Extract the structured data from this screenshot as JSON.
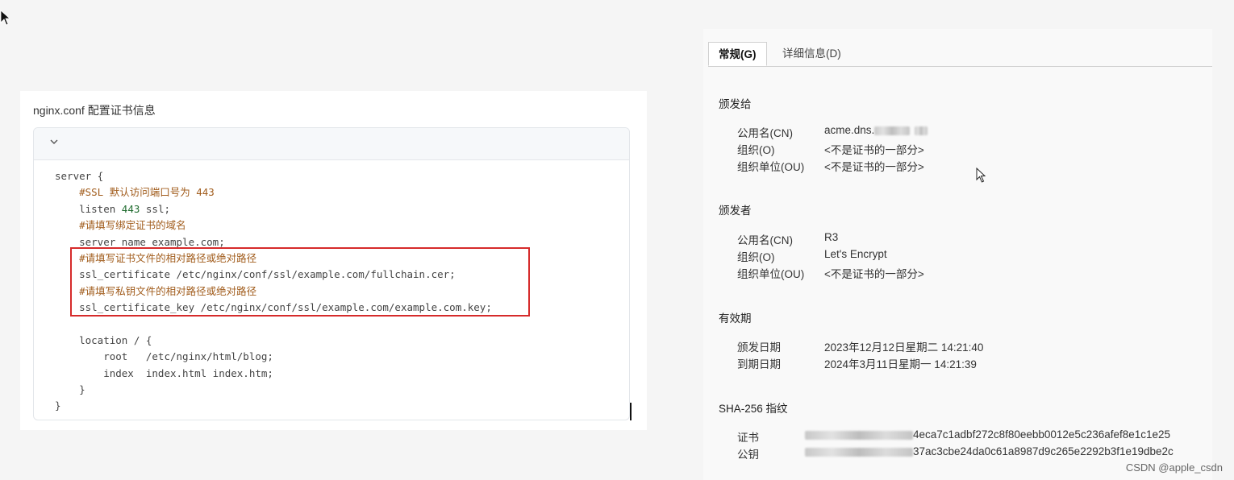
{
  "left": {
    "title": "nginx.conf 配置证书信息",
    "code_lines": [
      [
        {
          "t": "server {",
          "c": "kw"
        }
      ],
      [
        {
          "t": "    #SSL 默认访问端口号为 443",
          "c": "cm"
        }
      ],
      [
        {
          "t": "    listen ",
          "c": "kw"
        },
        {
          "t": "443",
          "c": "num"
        },
        {
          "t": " ssl;",
          "c": "kw"
        }
      ],
      [
        {
          "t": "    #请填写绑定证书的域名",
          "c": "cm"
        }
      ],
      [
        {
          "t": "    server_name example.com;",
          "c": "kw"
        }
      ],
      [
        {
          "t": "    #请填写证书文件的相对路径或绝对路径",
          "c": "cm"
        }
      ],
      [
        {
          "t": "    ssl_certificate /etc/nginx/conf/ssl/example.com/fullchain.cer;",
          "c": "kw"
        }
      ],
      [
        {
          "t": "    #请填写私钥文件的相对路径或绝对路径",
          "c": "cm"
        }
      ],
      [
        {
          "t": "    ssl_certificate_key /etc/nginx/conf/ssl/example.com/example.com.key;",
          "c": "kw"
        }
      ],
      [
        {
          "t": "",
          "c": "kw"
        }
      ],
      [
        {
          "t": "    location / {",
          "c": "kw"
        }
      ],
      [
        {
          "t": "        root   /etc/nginx/html/blog;",
          "c": "kw"
        }
      ],
      [
        {
          "t": "        index  index.html index.htm;",
          "c": "kw"
        }
      ],
      [
        {
          "t": "    }",
          "c": "kw"
        }
      ],
      [
        {
          "t": "}",
          "c": "kw"
        }
      ]
    ]
  },
  "right": {
    "tabs": {
      "general": "常规(G)",
      "details": "详细信息(D)"
    },
    "issued_to": {
      "title": "颁发给",
      "cn_label": "公用名(CN)",
      "cn_value": "acme.dns.",
      "o_label": "组织(O)",
      "o_value": "<不是证书的一部分>",
      "ou_label": "组织单位(OU)",
      "ou_value": "<不是证书的一部分>"
    },
    "issued_by": {
      "title": "颁发者",
      "cn_label": "公用名(CN)",
      "cn_value": "R3",
      "o_label": "组织(O)",
      "o_value": "Let's Encrypt",
      "ou_label": "组织单位(OU)",
      "ou_value": "<不是证书的一部分>"
    },
    "validity": {
      "title": "有效期",
      "issued_label": "颁发日期",
      "issued_value": "2023年12月12日星期二 14:21:40",
      "expires_label": "到期日期",
      "expires_value": "2024年3月11日星期一 14:21:39"
    },
    "fingerprint": {
      "title": "SHA-256 指纹",
      "cert_label": "证书",
      "cert_value": "4eca7c1adbf272c8f80eebb0012e5c236afef8e1c1e25",
      "key_label": "公钥",
      "key_value": "37ac3cbe24da0c61a8987d9c265e2292b3f1e19dbe2c"
    }
  },
  "footer": {
    "watermark": "CSDN @apple_csdn"
  }
}
